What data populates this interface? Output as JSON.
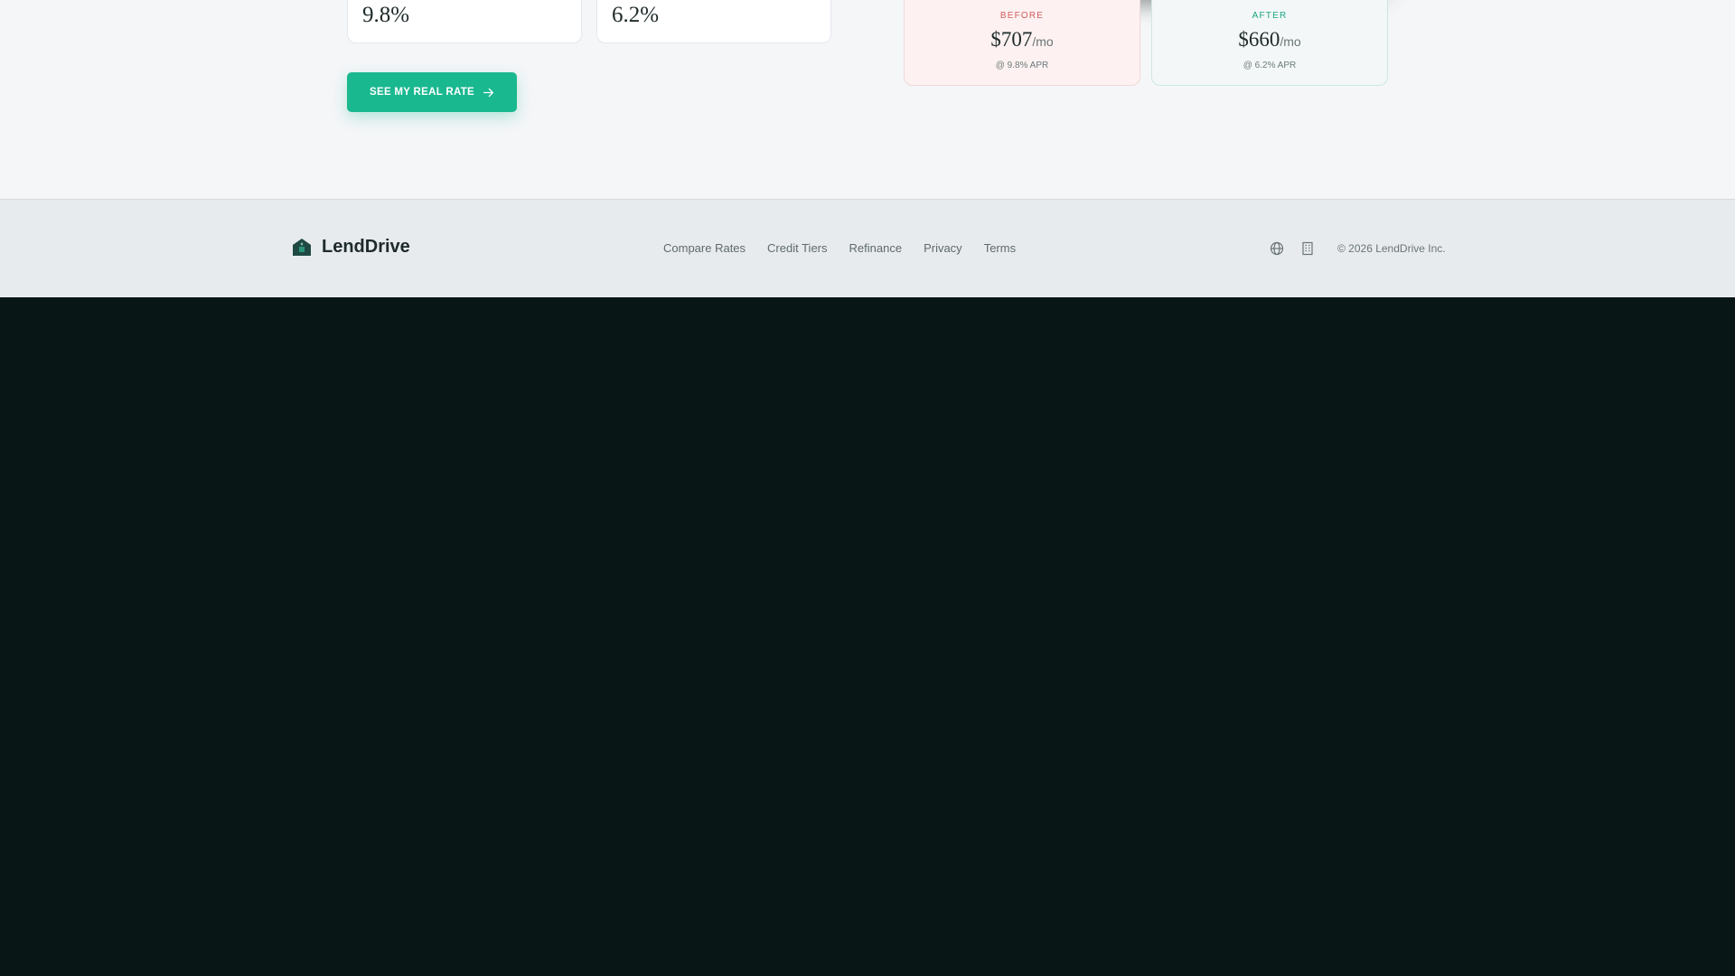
{
  "rates": {
    "current_value": "9.8%",
    "new_value": "6.2%"
  },
  "cta": {
    "label": "SEE MY REAL RATE",
    "icon": "arrow-right-icon"
  },
  "comparison": {
    "before": {
      "label": "BEFORE",
      "amount": "$707",
      "unit": "/mo",
      "apr": "@ 9.8% APR"
    },
    "after": {
      "label": "AFTER",
      "amount": "$660",
      "unit": "/mo",
      "apr": "@ 6.2% APR"
    }
  },
  "footer": {
    "brand": {
      "name": "LendDrive",
      "icon": "home-logo-icon"
    },
    "links": [
      {
        "label": "Compare Rates"
      },
      {
        "label": "Credit Tiers"
      },
      {
        "label": "Refinance"
      },
      {
        "label": "Privacy"
      },
      {
        "label": "Terms"
      }
    ],
    "icons": [
      "globe-icon",
      "building-icon"
    ],
    "copyright": "© 2026 LendDrive Inc."
  },
  "colors": {
    "accent": "#1ab88f",
    "before_accent": "#d45b5b",
    "after_accent": "#1aa583",
    "dark_background": "#081716"
  }
}
